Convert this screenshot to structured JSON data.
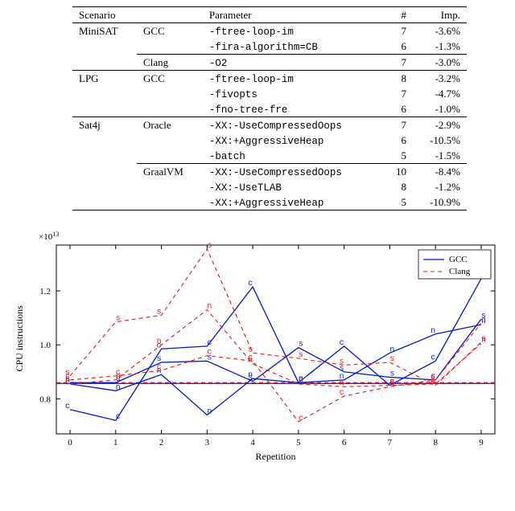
{
  "table": {
    "headers": {
      "scenario": "Scenario",
      "compiler": "",
      "parameter": "Parameter",
      "count": "#",
      "imp": "Imp."
    },
    "rows": [
      {
        "scenario": "MiniSAT",
        "compiler": "GCC",
        "params": [
          {
            "name": "-ftree-loop-im",
            "count": 7,
            "imp": "-3.6%"
          },
          {
            "name": "-fira-algorithm=CB",
            "count": 6,
            "imp": "-1.3%"
          }
        ]
      },
      {
        "scenario": "",
        "compiler": "Clang",
        "cm": true,
        "params": [
          {
            "name": "-O2",
            "count": 7,
            "imp": "-3.0%"
          }
        ]
      },
      {
        "scenario": "LPG",
        "compiler": "GCC",
        "rule": true,
        "params": [
          {
            "name": "-ftree-loop-im",
            "count": 8,
            "imp": "-3.2%"
          },
          {
            "name": "-fivopts",
            "count": 7,
            "imp": "-4.7%"
          },
          {
            "name": "-fno-tree-fre",
            "count": 6,
            "imp": "-1.0%"
          }
        ]
      },
      {
        "scenario": "Sat4j",
        "compiler": "Oracle",
        "rule": true,
        "params": [
          {
            "name": "-XX:-UseCompressedOops",
            "count": 7,
            "imp": "-2.9%"
          },
          {
            "name": "-XX:+AggressiveHeap",
            "count": 6,
            "imp": "-10.5%"
          },
          {
            "name": "-batch",
            "count": 5,
            "imp": "-1.5%"
          }
        ]
      },
      {
        "scenario": "",
        "compiler": "GraalVM",
        "cm": true,
        "params": [
          {
            "name": "-XX:-UseCompressedOops",
            "count": 10,
            "imp": "-8.4%"
          },
          {
            "name": "-XX:-UseTLAB",
            "count": 8,
            "imp": "-1.2%"
          },
          {
            "name": "-XX:+AggressiveHeap",
            "count": 5,
            "imp": "-10.9%"
          }
        ]
      }
    ]
  },
  "chart_data": {
    "type": "line",
    "xlabel": "Repetition",
    "ylabel": "CPU instructions",
    "y_multiplier_label": "×10^{13}",
    "x": [
      0,
      1,
      2,
      3,
      4,
      5,
      6,
      7,
      8,
      9
    ],
    "ylim": [
      0.67,
      1.37
    ],
    "yticks": [
      0.8,
      1.0,
      1.2
    ],
    "units": "1e13",
    "baseline_gcc": 0.857,
    "baseline_clang": 0.86,
    "series": [
      {
        "name": "GCC",
        "color": "#0018c9",
        "style": "solid",
        "runs": [
          {
            "tag": "c",
            "y": [
              0.76,
              0.72,
              0.985,
              0.995,
              1.215,
              0.86,
              0.995,
              0.85,
              0.94,
              1.245
            ]
          },
          {
            "tag": "n",
            "y": [
              0.855,
              0.83,
              0.89,
              0.74,
              0.875,
              0.86,
              0.87,
              0.97,
              1.04,
              1.075
            ]
          },
          {
            "tag": "s",
            "y": [
              0.86,
              0.86,
              0.935,
              0.94,
              0.865,
              0.99,
              0.9,
              0.88,
              0.87,
              1.095
            ]
          }
        ]
      },
      {
        "name": "Clang",
        "color": "#e11",
        "style": "dashed",
        "runs": [
          {
            "tag": "c",
            "y": [
              0.87,
              0.885,
              0.905,
              0.96,
              0.94,
              0.715,
              0.81,
              0.845,
              0.87,
              1.08
            ]
          },
          {
            "tag": "n",
            "y": [
              0.855,
              0.87,
              1.0,
              1.13,
              0.93,
              0.855,
              0.845,
              0.85,
              0.855,
              1.005
            ]
          },
          {
            "tag": "s",
            "y": [
              0.885,
              1.085,
              1.11,
              1.355,
              0.97,
              0.95,
              0.925,
              0.935,
              0.85,
              1.01
            ]
          }
        ]
      }
    ],
    "legend": {
      "entries": [
        "GCC",
        "Clang"
      ],
      "position": "top-right"
    }
  }
}
